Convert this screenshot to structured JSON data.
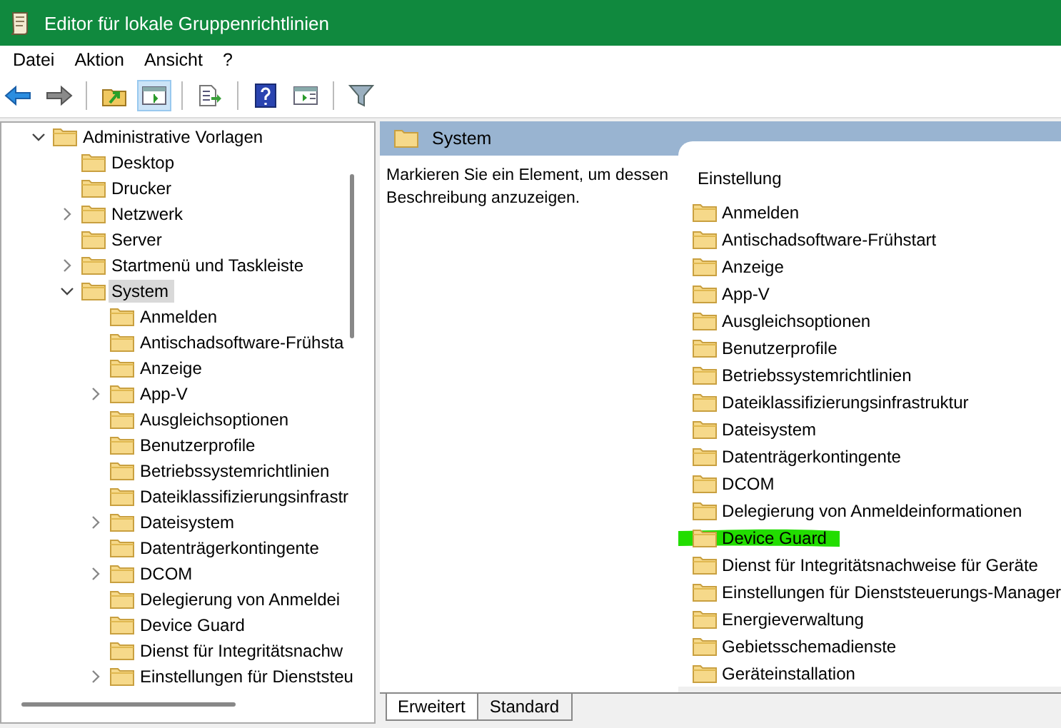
{
  "window": {
    "title": "Editor für lokale Gruppenrichtlinien"
  },
  "menu": [
    "Datei",
    "Aktion",
    "Ansicht",
    "?"
  ],
  "toolbar": [
    {
      "kind": "back",
      "selected": false
    },
    {
      "kind": "forward",
      "selected": false
    },
    {
      "kind": "up",
      "selected": false
    },
    {
      "kind": "tree",
      "selected": true
    },
    {
      "kind": "export",
      "selected": false
    },
    {
      "kind": "help",
      "selected": false
    },
    {
      "kind": "pane",
      "selected": false
    },
    {
      "kind": "filter",
      "selected": false
    }
  ],
  "tree": [
    {
      "label": "Administrative Vorlagen",
      "kind": "open",
      "selected": false,
      "children": [
        {
          "label": "Desktop",
          "kind": "leaf",
          "selected": false
        },
        {
          "label": "Drucker",
          "kind": "leaf",
          "selected": false
        },
        {
          "label": "Netzwerk",
          "kind": "closed",
          "selected": false
        },
        {
          "label": "Server",
          "kind": "leaf",
          "selected": false
        },
        {
          "label": "Startmenü und Taskleiste",
          "kind": "closed",
          "selected": false
        },
        {
          "label": "System",
          "kind": "open",
          "selected": true,
          "children": [
            {
              "label": "Anmelden",
              "kind": "leaf",
              "selected": false
            },
            {
              "label": "Antischadsoftware-Frühsta",
              "kind": "leaf",
              "selected": false
            },
            {
              "label": "Anzeige",
              "kind": "leaf",
              "selected": false
            },
            {
              "label": "App-V",
              "kind": "closed",
              "selected": false
            },
            {
              "label": "Ausgleichsoptionen",
              "kind": "leaf",
              "selected": false
            },
            {
              "label": "Benutzerprofile",
              "kind": "leaf",
              "selected": false
            },
            {
              "label": "Betriebssystemrichtlinien",
              "kind": "leaf",
              "selected": false
            },
            {
              "label": "Dateiklassifizierungsinfrastr",
              "kind": "leaf",
              "selected": false
            },
            {
              "label": "Dateisystem",
              "kind": "closed",
              "selected": false
            },
            {
              "label": "Datenträgerkontingente",
              "kind": "leaf",
              "selected": false
            },
            {
              "label": "DCOM",
              "kind": "closed",
              "selected": false
            },
            {
              "label": "Delegierung von Anmeldei",
              "kind": "leaf",
              "selected": false
            },
            {
              "label": "Device Guard",
              "kind": "leaf",
              "selected": false
            },
            {
              "label": "Dienst für Integritätsnachw",
              "kind": "leaf",
              "selected": false
            },
            {
              "label": "Einstellungen für Dienststeu",
              "kind": "closed",
              "selected": false
            }
          ]
        }
      ]
    }
  ],
  "details": {
    "title": "System",
    "description": "Markieren Sie ein Element, um dessen Beschreibung anzuzeigen.",
    "column": "Einstellung",
    "items": [
      {
        "label": "Anmelden",
        "highlighted": false
      },
      {
        "label": "Antischadsoftware-Frühstart",
        "highlighted": false
      },
      {
        "label": "Anzeige",
        "highlighted": false
      },
      {
        "label": "App-V",
        "highlighted": false
      },
      {
        "label": "Ausgleichsoptionen",
        "highlighted": false
      },
      {
        "label": "Benutzerprofile",
        "highlighted": false
      },
      {
        "label": "Betriebssystemrichtlinien",
        "highlighted": false
      },
      {
        "label": "Dateiklassifizierungsinfrastruktur",
        "highlighted": false
      },
      {
        "label": "Dateisystem",
        "highlighted": false
      },
      {
        "label": "Datenträgerkontingente",
        "highlighted": false
      },
      {
        "label": "DCOM",
        "highlighted": false
      },
      {
        "label": "Delegierung von Anmeldeinformationen",
        "highlighted": false
      },
      {
        "label": "Device Guard",
        "highlighted": true
      },
      {
        "label": "Dienst für Integritätsnachweise für Geräte",
        "highlighted": false
      },
      {
        "label": "Einstellungen für Dienststeuerungs-Manager",
        "highlighted": false
      },
      {
        "label": "Energieverwaltung",
        "highlighted": false
      },
      {
        "label": "Gebietsschemadienste",
        "highlighted": false
      },
      {
        "label": "Geräteinstallation",
        "highlighted": false
      }
    ]
  },
  "tabs": [
    {
      "label": "Erweitert",
      "selected": true
    },
    {
      "label": "Standard",
      "selected": false
    }
  ]
}
